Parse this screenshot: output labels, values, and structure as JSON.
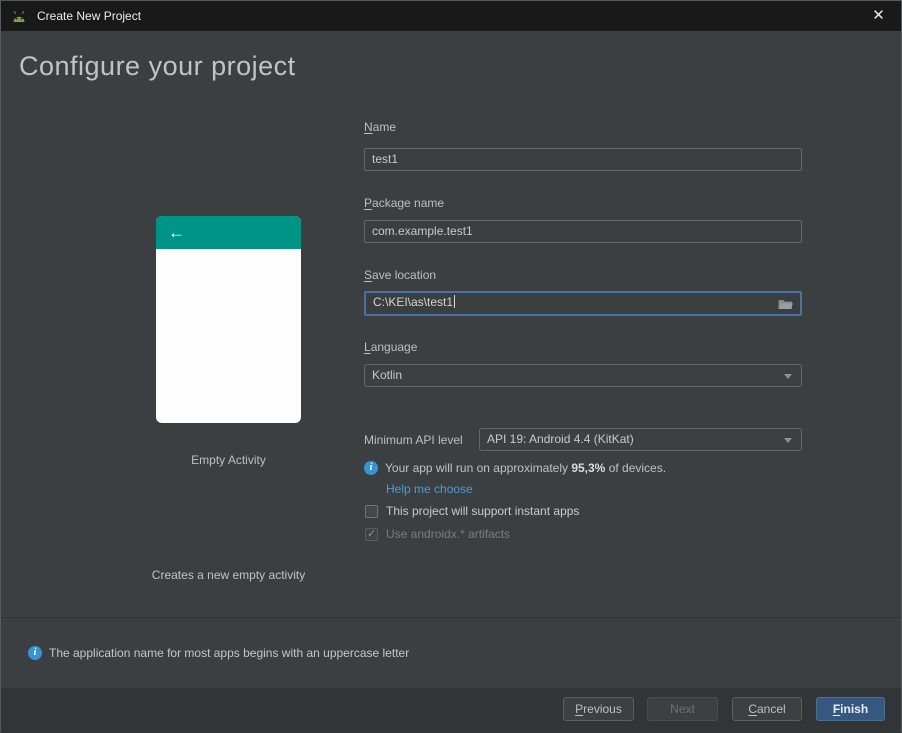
{
  "window": {
    "title": "Create New Project",
    "close_glyph": "✕"
  },
  "header": {
    "title": "Configure your project"
  },
  "preview": {
    "template_name": "Empty Activity",
    "description": "Creates a new empty activity",
    "accent_color": "#009688",
    "back_arrow": "←"
  },
  "form": {
    "name": {
      "label": "Name",
      "value": "test1"
    },
    "package": {
      "label": "Package name",
      "value": "com.example.test1"
    },
    "location": {
      "label": "Save location",
      "value": "C:\\KEI\\as\\test1"
    },
    "language": {
      "label": "Language",
      "value": "Kotlin"
    },
    "api": {
      "label": "Minimum API level",
      "value": "API 19: Android 4.4 (KitKat)"
    },
    "api_info": {
      "prefix": "Your app will run on approximately ",
      "highlight": "95,3%",
      "suffix": " of devices."
    },
    "help_link": "Help me choose",
    "instant_apps": {
      "label": "This project will support instant apps",
      "checked": false
    },
    "androidx": {
      "label": "Use androidx.* artifacts",
      "checked": true,
      "disabled": true
    }
  },
  "footer": {
    "hint": "The application name for most apps begins with an uppercase letter"
  },
  "buttons": {
    "previous": "Previous",
    "next": "Next",
    "cancel": "Cancel",
    "finish": "Finish"
  },
  "colors": {
    "background": "#3c3f41",
    "titlebar": "#191919",
    "accent_teal": "#009688",
    "finish_blue": "#365880",
    "link_blue": "#4a9cd6",
    "info_blue": "#3794d1",
    "focus_border": "#4972a4"
  }
}
